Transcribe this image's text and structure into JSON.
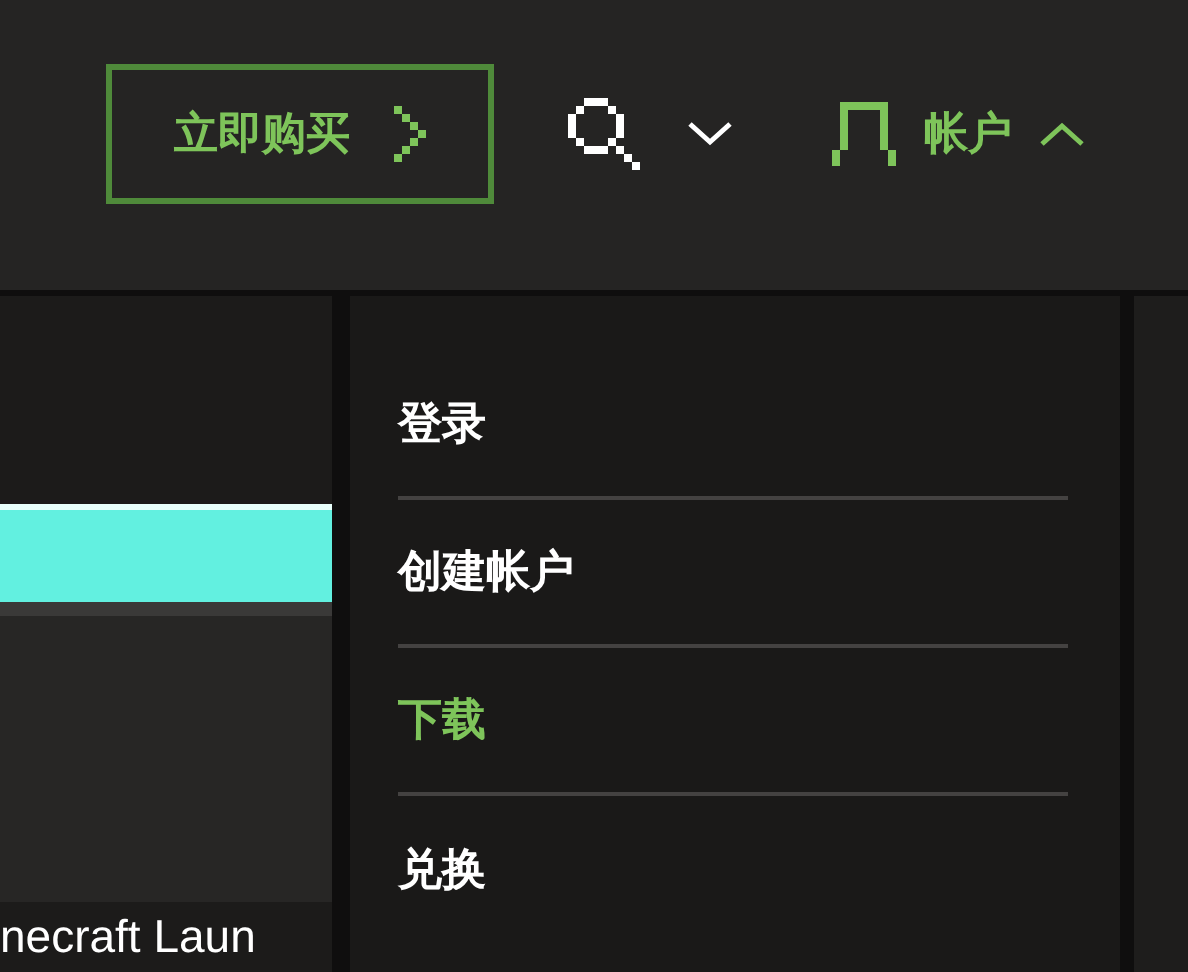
{
  "header": {
    "buy_button": {
      "label": "立即购买"
    },
    "search": {
      "expanded": false
    },
    "account": {
      "label": "帐户",
      "expanded": true
    }
  },
  "content": {
    "caption": "necraft Laun"
  },
  "account_menu": {
    "items": [
      {
        "label": "登录",
        "selected": false
      },
      {
        "label": "创建帐户",
        "selected": false
      },
      {
        "label": "下载",
        "selected": true
      },
      {
        "label": "兑换",
        "selected": false
      }
    ]
  }
}
